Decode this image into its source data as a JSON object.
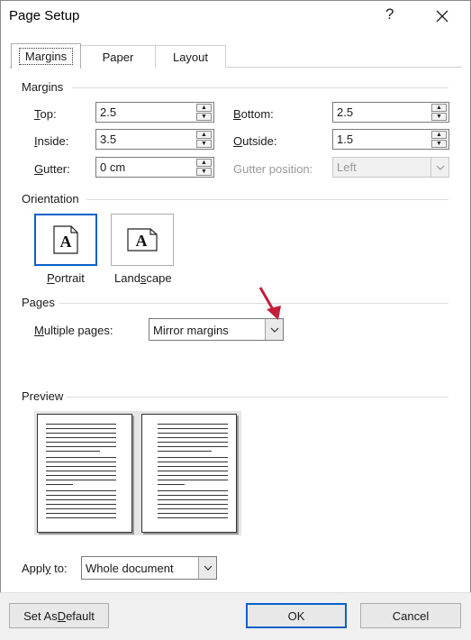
{
  "window": {
    "title": "Page Setup",
    "help_label": "?"
  },
  "tabs": [
    {
      "label": "Margins",
      "active": true
    },
    {
      "label": "Paper",
      "active": false
    },
    {
      "label": "Layout",
      "active": false
    }
  ],
  "margins": {
    "section_label": "Margins",
    "top": {
      "label": "Top:",
      "value": "2.5"
    },
    "bottom": {
      "label": "Bottom:",
      "value": "2.5"
    },
    "inside": {
      "label": "Inside:",
      "value": "3.5"
    },
    "outside": {
      "label": "Outside:",
      "value": "1.5"
    },
    "gutter": {
      "label": "Gutter:",
      "value": "0 cm"
    },
    "gutter_position": {
      "label": "Gutter position:",
      "value": "Left",
      "disabled": true
    }
  },
  "orientation": {
    "section_label": "Orientation",
    "portrait_label": "Portrait",
    "landscape_label": "Landscape",
    "selected": "Portrait",
    "icon_glyph": "A"
  },
  "pages": {
    "section_label": "Pages",
    "multiple_pages_label": "Multiple pages:",
    "multiple_pages_value": "Mirror margins"
  },
  "preview": {
    "section_label": "Preview"
  },
  "apply_to": {
    "label": "Apply to:",
    "value": "Whole document"
  },
  "footer": {
    "set_default_label": "Set As Default",
    "ok_label": "OK",
    "cancel_label": "Cancel"
  },
  "colors": {
    "accent": "#0a62c9",
    "annotation_arrow": "#c41e3a"
  }
}
